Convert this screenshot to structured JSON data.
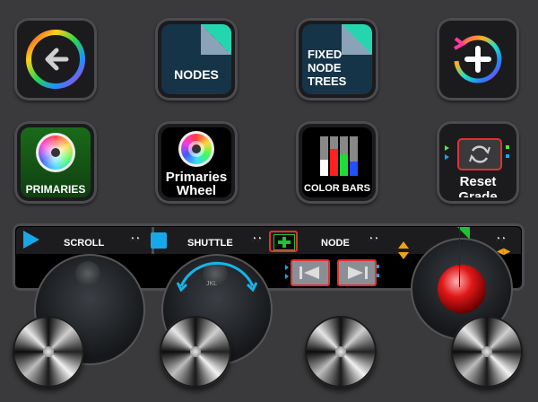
{
  "keys": {
    "nodes_label": "NODES",
    "fixed_node_trees_label": "FIXED\nNODE\nTREES",
    "primaries_label": "PRIMARIES",
    "primaries_wheel_label": "Primaries\nWheel",
    "color_bars_label": "COLOR BARS",
    "reset_grade_label": "Reset Grade"
  },
  "strip": {
    "scroll_label": "SCROLL",
    "shuttle_label": "SHUTTLE",
    "node_label": "NODE",
    "jkl_label": "JKL"
  },
  "colors": {
    "accent_teal": "#24d6b0",
    "play_blue": "#16a8e8",
    "green_add": "#1ec232",
    "red_outline": "#e33030",
    "amber": "#e9a317"
  }
}
